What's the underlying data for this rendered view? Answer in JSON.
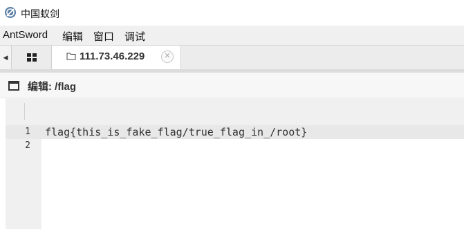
{
  "window": {
    "title": "中国蚁剑"
  },
  "menu": {
    "items": [
      "AntSword",
      "编辑",
      "窗口",
      "调试"
    ]
  },
  "tabs": {
    "scroll_left_glyph": "◀",
    "active": {
      "label": "111.73.46.229",
      "close_glyph": "✕"
    }
  },
  "panel": {
    "title": "编辑: /flag"
  },
  "editor": {
    "lines": [
      {
        "number": "1",
        "text": "flag{this_is_fake_flag/true_flag_in_/root}"
      },
      {
        "number": "2",
        "text": ""
      }
    ]
  }
}
